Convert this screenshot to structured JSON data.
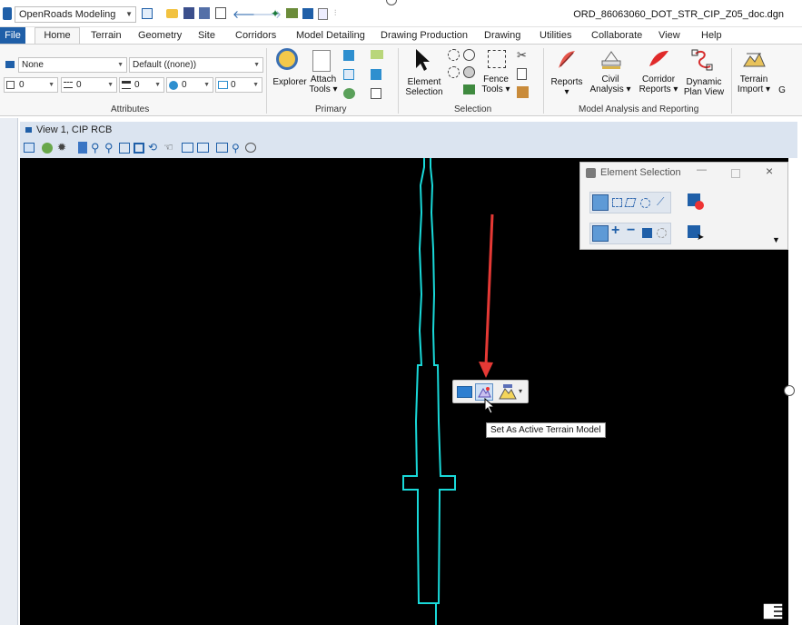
{
  "titlebar": {
    "workspace": "OpenRoads Modeling",
    "document_title": "ORD_86063060_DOT_STR_CIP_Z05_doc.dgn"
  },
  "tabs": [
    "File",
    "Home",
    "Terrain",
    "Geometry",
    "Site",
    "Corridors",
    "Model Detailing",
    "Drawing Production",
    "Drawing",
    "Utilities",
    "Collaborate",
    "View",
    "Help"
  ],
  "ribbon": {
    "attributes": {
      "level": "None",
      "template": "Default ((none))",
      "color": "0",
      "style": "0",
      "weight": "0",
      "priority": "0",
      "transparency": "0",
      "group_label": "Attributes"
    },
    "primary": {
      "explorer": "Explorer",
      "attach_tools": [
        "Attach",
        "Tools"
      ],
      "group_label": "Primary"
    },
    "selection": {
      "element_selection": [
        "Element",
        "Selection"
      ],
      "fence_tools": [
        "Fence",
        "Tools"
      ],
      "group_label": "Selection"
    },
    "analysis": {
      "reports": "Reports",
      "civil_analysis": [
        "Civil",
        "Analysis"
      ],
      "corridor_reports": [
        "Corridor",
        "Reports"
      ],
      "dynamic_plan_view": [
        "Dynamic",
        "Plan View"
      ],
      "group_label": "Model Analysis and Reporting"
    },
    "terrain": {
      "terrain_import": [
        "Terrain",
        "Import"
      ],
      "cut": "G"
    }
  },
  "view": {
    "title": "View 1, CIP RCB"
  },
  "element_selection": {
    "title": "Element Selection"
  },
  "tooltip": "Set As Active Terrain Model",
  "colors": {
    "accent": "#1f5fa8",
    "terrain_line": "#19d9d9",
    "arrow": "#e53935",
    "canvas": "#000000"
  }
}
